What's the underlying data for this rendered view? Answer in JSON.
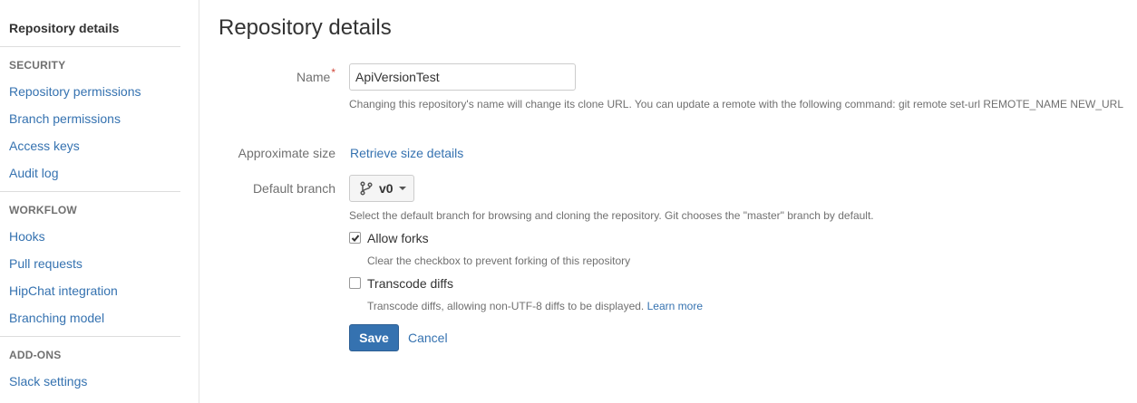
{
  "sidebar": {
    "current": "Repository details",
    "sections": [
      {
        "heading": "SECURITY",
        "items": [
          "Repository permissions",
          "Branch permissions",
          "Access keys",
          "Audit log"
        ]
      },
      {
        "heading": "WORKFLOW",
        "items": [
          "Hooks",
          "Pull requests",
          "HipChat integration",
          "Branching model"
        ]
      },
      {
        "heading": "ADD-ONS",
        "items": [
          "Slack settings"
        ]
      }
    ]
  },
  "main": {
    "title": "Repository details",
    "name_field": {
      "label": "Name",
      "required_marker": "*",
      "value": "ApiVersionTest",
      "description": "Changing this repository's name will change its clone URL. You can update a remote with the following command: git remote set-url REMOTE_NAME NEW_URL"
    },
    "size": {
      "label": "Approximate size",
      "link": "Retrieve size details"
    },
    "default_branch": {
      "label": "Default branch",
      "value": "v0",
      "icon": "branch-icon",
      "description": "Select the default branch for browsing and cloning the repository. Git chooses the \"master\" branch by default."
    },
    "allow_forks": {
      "label": "Allow forks",
      "checked": true,
      "description": "Clear the checkbox to prevent forking of this repository"
    },
    "transcode_diffs": {
      "label": "Transcode diffs",
      "checked": false,
      "description": "Transcode diffs, allowing non-UTF-8 diffs to be displayed.",
      "learn_more": "Learn more"
    },
    "save_label": "Save",
    "cancel_label": "Cancel"
  },
  "colors": {
    "link": "#3572b0",
    "primary_button": "#3572b0",
    "required": "#d04437",
    "muted_text": "#707070"
  }
}
